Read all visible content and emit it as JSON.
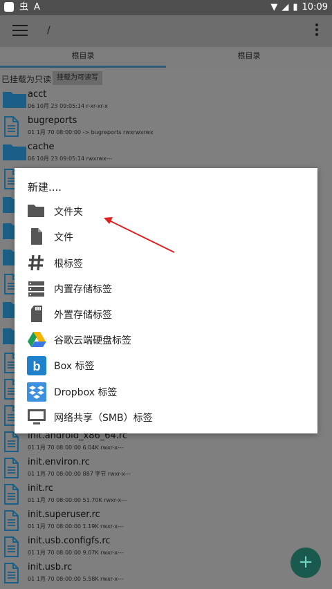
{
  "status": {
    "time": "10:09"
  },
  "appbar": {
    "path": "/"
  },
  "tabs": [
    {
      "label": "根目录"
    },
    {
      "label": "根目录"
    }
  ],
  "mount": {
    "status": "已挂载为只读",
    "button": "挂载为可读写"
  },
  "files": [
    {
      "name": "acct",
      "meta": "06 10月 23 09:05:14   r-xr-xr-x",
      "type": "folder"
    },
    {
      "name": "bugreports",
      "meta": "01 1月 70 08:00:00  -> bugreports  rwxrwxrwx",
      "type": "file"
    },
    {
      "name": "cache",
      "meta": "06 10月 23 09:05:14   rwxrwx---",
      "type": "folder"
    },
    {
      "name": "",
      "meta": "",
      "type": "file"
    },
    {
      "name": "",
      "meta": "",
      "type": "folder"
    },
    {
      "name": "",
      "meta": "",
      "type": "folder"
    },
    {
      "name": "",
      "meta": "",
      "type": "folder"
    },
    {
      "name": "",
      "meta": "",
      "type": "file"
    },
    {
      "name": "",
      "meta": "",
      "type": "folder"
    },
    {
      "name": "",
      "meta": "",
      "type": "folder"
    },
    {
      "name": "",
      "meta": "",
      "type": "file"
    },
    {
      "name": "",
      "meta": "",
      "type": "file"
    },
    {
      "name": "",
      "meta": "",
      "type": "file"
    },
    {
      "name": "init.android_x86_64.rc",
      "meta": "01 1月 70 08:00:00   6.04K   rwxr-x---",
      "type": "file"
    },
    {
      "name": "init.environ.rc",
      "meta": "01 1月 70 08:00:00   887 字节   rwxr-x---",
      "type": "file"
    },
    {
      "name": "init.rc",
      "meta": "01 1月 70 08:00:00   51.70K   rwxr-x---",
      "type": "file"
    },
    {
      "name": "init.superuser.rc",
      "meta": "01 1月 70 08:00:00   1.19K   rwxr-x---",
      "type": "file"
    },
    {
      "name": "init.usb.configfs.rc",
      "meta": "01 1月 70 08:00:00   9.07K   rwxr-x---",
      "type": "file"
    },
    {
      "name": "init.usb.rc",
      "meta": "01 1月 70 08:00:00   5.58K   rwxr-x---",
      "type": "file"
    }
  ],
  "dialog": {
    "title": "新建....",
    "options": [
      {
        "label": "文件夹",
        "icon": "folder-icon"
      },
      {
        "label": "文件",
        "icon": "file-icon"
      },
      {
        "label": "根标签",
        "icon": "hash-icon"
      },
      {
        "label": "内置存储标签",
        "icon": "storage-icon"
      },
      {
        "label": "外置存储标签",
        "icon": "sdcard-icon"
      },
      {
        "label": "谷歌云端硬盘标签",
        "icon": "google-drive-icon"
      },
      {
        "label": "Box 标签",
        "icon": "box-icon"
      },
      {
        "label": "Dropbox 标签",
        "icon": "dropbox-icon"
      },
      {
        "label": "网络共享（SMB）标签",
        "icon": "monitor-icon"
      }
    ]
  },
  "fab": {
    "label": "+"
  },
  "colors": {
    "folder": "#1c5f86",
    "file": "#1c5f86",
    "fab": "#1a5a4e",
    "arrow": "#e02020",
    "accent": "#2f5b74"
  }
}
